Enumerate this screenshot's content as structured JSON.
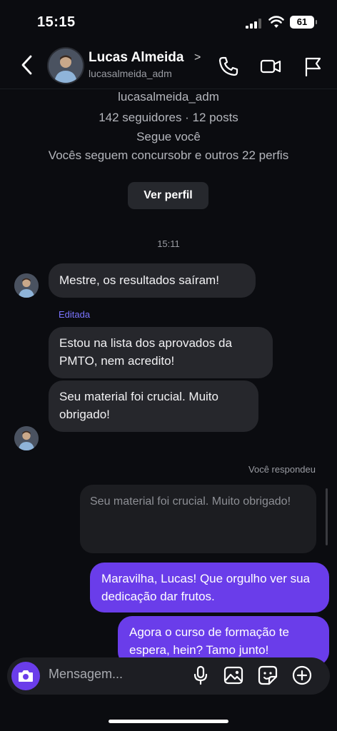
{
  "status_bar": {
    "time": "15:15",
    "battery": "61"
  },
  "header": {
    "name": "Lucas Almeida",
    "handle": "lucasalmeida_adm"
  },
  "profile_info": {
    "handle": "lucasalmeida_adm",
    "stats": "142 seguidores · 12 posts",
    "follows_you": "Segue você",
    "mutual": "Vocês seguem concursobr e outros 22 perfis",
    "view_profile_label": "Ver perfil"
  },
  "timestamp": "15:11",
  "messages": {
    "m1": "Mestre, os resultados saíram!",
    "edited_label": "Editada",
    "m2": "Estou na lista dos aprovados da PMTO, nem acredito!",
    "m3": "Seu material foi crucial. Muito obrigado!",
    "replied_label": "Você respondeu",
    "quoted": "Seu material foi crucial. Muito obrigado!",
    "r1": "Maravilha, Lucas! Que orgulho ver sua dedicação dar frutos.",
    "r2": "Agora o curso de formação te espera, hein? Tamo junto!"
  },
  "composer": {
    "placeholder": "Mensagem..."
  },
  "colors": {
    "accent": "#6a3dea",
    "incoming_bubble": "#26272c",
    "background": "#0b0c10"
  },
  "icons": [
    "back-icon",
    "phone-icon",
    "video-icon",
    "flag-icon",
    "camera-icon",
    "microphone-icon",
    "gallery-icon",
    "sticker-icon",
    "plus-icon"
  ]
}
